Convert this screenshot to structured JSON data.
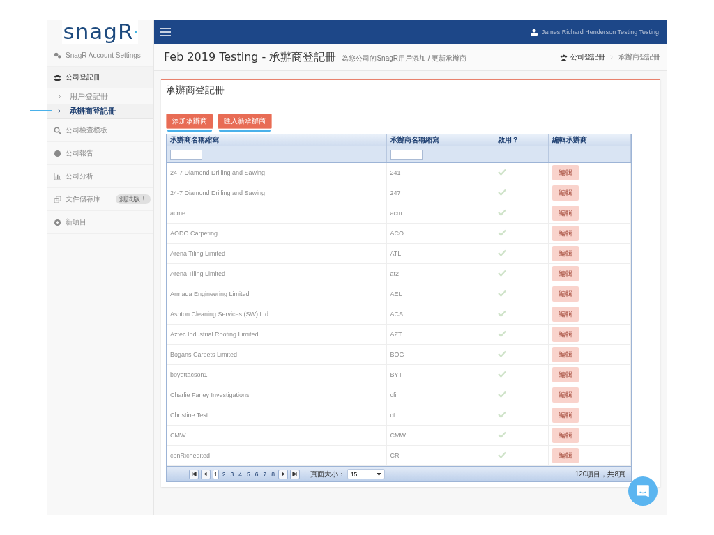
{
  "logo": "snagR",
  "topbar": {
    "user": "James Richard Henderson Testing Testing"
  },
  "sidebar": {
    "items": [
      {
        "label": "SnagR Account Settings",
        "disabled": true,
        "expanded": false
      },
      {
        "label": "公司登記冊",
        "disabled": false,
        "expanded": true,
        "children": [
          {
            "label": "用戶登記冊",
            "disabled": true,
            "selected": false,
            "highlighted": false
          },
          {
            "label": "承辦商登記冊",
            "disabled": false,
            "selected": true,
            "highlighted": true
          }
        ]
      },
      {
        "label": "公司檢查模板",
        "disabled": true,
        "expanded": false
      },
      {
        "label": "公司報告",
        "disabled": true,
        "expanded": false
      },
      {
        "label": "公司分析",
        "disabled": true,
        "expanded": false
      },
      {
        "label": "文件儲存庫",
        "disabled": true,
        "expanded": false,
        "badge": "測試版！"
      },
      {
        "label": "新項目",
        "disabled": true,
        "expanded": false
      }
    ]
  },
  "header": {
    "title": "Feb 2019 Testing - 承辦商登記冊",
    "subtitle": "為您公司的SnagR用戶添加 / 更新承辦商",
    "breadcrumb": [
      "公司登記冊",
      "承辦商登記冊"
    ]
  },
  "panel": {
    "title": "承辦商登記冊",
    "buttons": [
      {
        "label": "添加承辦商",
        "highlighted": true
      },
      {
        "label": "匯入新承辦商",
        "highlighted": true
      }
    ],
    "table": {
      "columns": [
        {
          "label": "承辦商名稱縮寫",
          "filter": true
        },
        {
          "label": "承辦商名稱縮寫",
          "filter": true
        },
        {
          "label": "啟用？",
          "filter": false
        },
        {
          "label": "編輯承辦商",
          "filter": false
        }
      ],
      "rows": [
        {
          "name": "24-7 Diamond Drilling and Sawing",
          "code": "241",
          "enabled": true,
          "action": "編輯"
        },
        {
          "name": "24-7 Diamond Drilling and Sawing",
          "code": "247",
          "enabled": true,
          "action": "編輯"
        },
        {
          "name": "acme",
          "code": "acm",
          "enabled": true,
          "action": "編輯"
        },
        {
          "name": "AODO Carpeting",
          "code": "ACO",
          "enabled": true,
          "action": "編輯"
        },
        {
          "name": "Arena Tiling Limited",
          "code": "ATL",
          "enabled": true,
          "action": "編輯"
        },
        {
          "name": "Arena Tiling Limited",
          "code": "at2",
          "enabled": true,
          "action": "編輯"
        },
        {
          "name": "Armada Engineering Limited",
          "code": "AEL",
          "enabled": true,
          "action": "編輯"
        },
        {
          "name": "Ashton Cleaning Services (SW) Ltd",
          "code": "ACS",
          "enabled": true,
          "action": "編輯"
        },
        {
          "name": "Aztec Industrial Roofing Limited",
          "code": "AZT",
          "enabled": true,
          "action": "編輯"
        },
        {
          "name": "Bogans Carpets Limited",
          "code": "BOG",
          "enabled": true,
          "action": "編輯"
        },
        {
          "name": "boyettacson1",
          "code": "BYT",
          "enabled": true,
          "action": "編輯"
        },
        {
          "name": "Charlie Farley Investigations",
          "code": "cfi",
          "enabled": true,
          "action": "編輯"
        },
        {
          "name": "Christine Test",
          "code": "ct",
          "enabled": true,
          "action": "編輯"
        },
        {
          "name": "CMW",
          "code": "CMW",
          "enabled": true,
          "action": "編輯"
        },
        {
          "name": "conRichedited",
          "code": "CR",
          "enabled": true,
          "action": "編輯"
        }
      ],
      "pager": {
        "pages": [
          {
            "label": "1",
            "selected": true
          },
          {
            "label": "2",
            "selected": false
          },
          {
            "label": "3",
            "selected": false
          },
          {
            "label": "4",
            "selected": false
          },
          {
            "label": "5",
            "selected": false
          },
          {
            "label": "6",
            "selected": false
          },
          {
            "label": "7",
            "selected": false
          },
          {
            "label": "8",
            "selected": false
          }
        ],
        "page_size_label": "頁面大小：",
        "page_size": "15",
        "summary": "120項目，共8頁"
      }
    }
  }
}
